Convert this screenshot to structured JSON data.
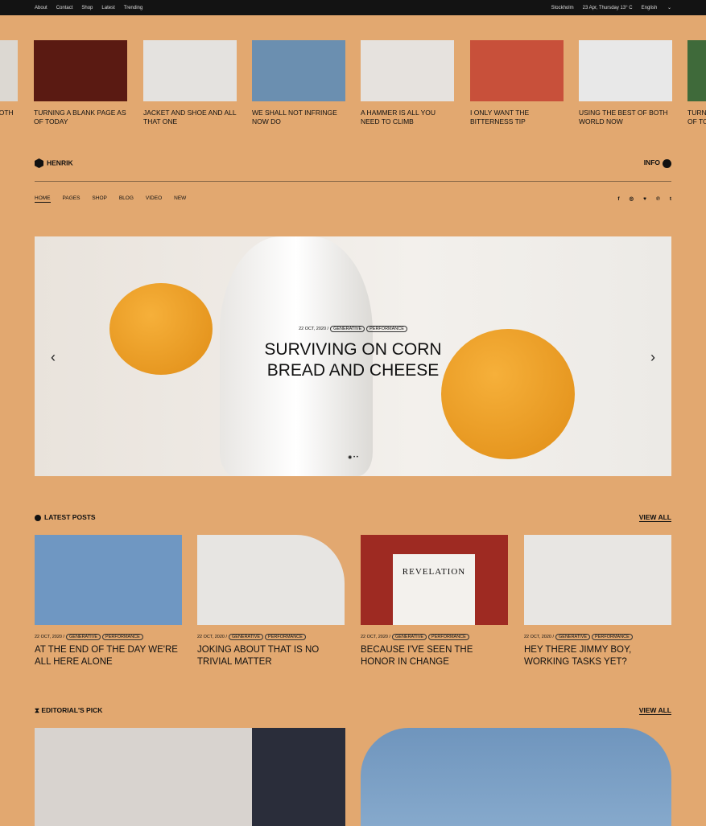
{
  "topbar": {
    "links": [
      "About",
      "Contact",
      "Shop",
      "Latest",
      "Trending"
    ],
    "city": "Stockholm",
    "date": "23 Apr, Thursday 13° C",
    "language": "English"
  },
  "strip": [
    {
      "title": "Using the best of both world now",
      "color": "#dcd8d2"
    },
    {
      "title": "Turning a blank page as of today",
      "color": "#5a1a12"
    },
    {
      "title": "Jacket and shoe and all that one",
      "color": "#e4e2df"
    },
    {
      "title": "We shall not infringe now do",
      "color": "#6b8fb0"
    },
    {
      "title": "A hammer is all you need to climb",
      "color": "#e6e2de"
    },
    {
      "title": "I only want the bitterness tip",
      "color": "#c8503a"
    },
    {
      "title": "Using the best of both world now",
      "color": "#e8e8e8"
    },
    {
      "title": "Turning a blank page as of today",
      "color": "#3f6a3a"
    }
  ],
  "brand": {
    "name": "HENRIK",
    "info": "INFO"
  },
  "nav": {
    "items": [
      "HOME",
      "PAGES",
      "SHOP",
      "BLOG",
      "VIDEO",
      "NEW"
    ],
    "social": [
      "f",
      "◎",
      "♥",
      "℗",
      "t"
    ]
  },
  "hero": {
    "date": "22 OCT, 2020 /",
    "tags": [
      "GENERATIVE",
      "PERFORMANCE"
    ],
    "title_line1": "SURVIVING ON CORN",
    "title_line2": "BREAD AND CHEESE",
    "prev": "‹",
    "next": "›"
  },
  "latest": {
    "title": "LATEST POSTS",
    "view_all": "VIEW ALL",
    "posts": [
      {
        "date": "22 OCT, 2020 /",
        "tags": [
          "GENERATIVE",
          "PERFORMANCE"
        ],
        "title": "At the end of the day we're all here alone",
        "color": "#6f97c2"
      },
      {
        "date": "22 OCT, 2020 /",
        "tags": [
          "GENERATIVE",
          "PERFORMANCE"
        ],
        "title": "Joking about that is no trivial matter",
        "color": "#e7e5e2"
      },
      {
        "date": "22 OCT, 2020 /",
        "tags": [
          "GENERATIVE",
          "PERFORMANCE"
        ],
        "title": "Because I've seen the honor in change",
        "color": "#9e2a22",
        "book": "REVELATION"
      },
      {
        "date": "22 OCT, 2020 /",
        "tags": [
          "GENERATIVE",
          "PERFORMANCE"
        ],
        "title": "Hey there Jimmy boy, working tasks yet?",
        "color": "#e8e6e3"
      }
    ]
  },
  "editorial": {
    "title": "EDITORIAL'S PICK",
    "view_all": "VIEW ALL"
  }
}
